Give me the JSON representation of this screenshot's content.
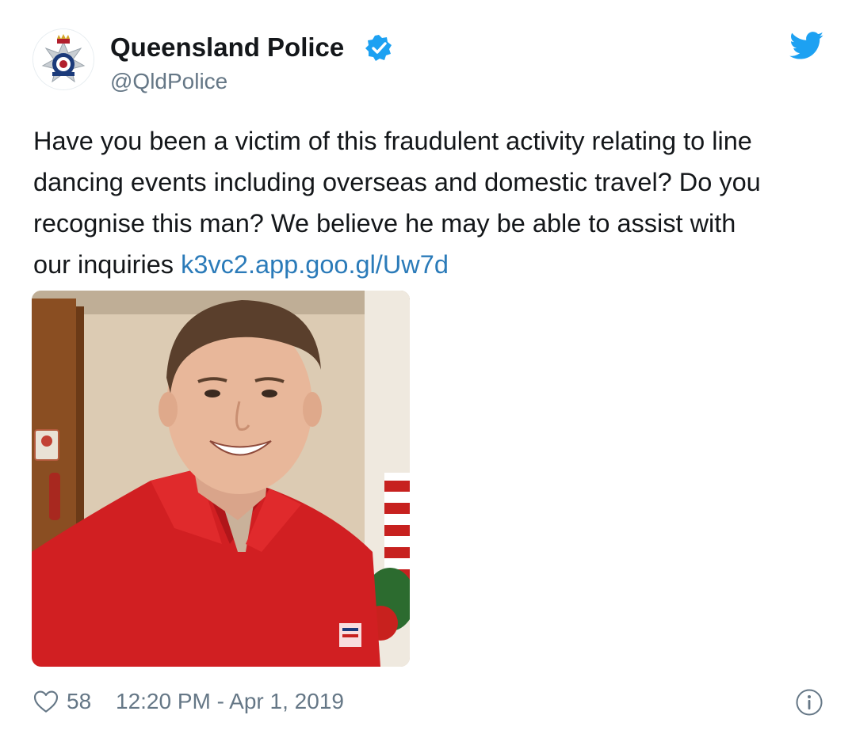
{
  "author": {
    "display_name": "Queensland Police",
    "handle": "@QldPolice",
    "verified": true,
    "avatar_icon": "police-badge-icon"
  },
  "tweet": {
    "text_lines": [
      "Have you been a victim of this fraudulent activity relating to line",
      "dancing events including overseas and domestic travel? Do you",
      "recognise this man? We believe he may be able to assist with",
      "our inquiries "
    ],
    "link_text": "k3vc2.app.goo.gl/Uw7d",
    "image_icon": "photo-of-man-in-red-shirt"
  },
  "footer": {
    "like_count": "58",
    "timestamp": "12:20 PM - Apr 1, 2019"
  },
  "icons": {
    "twitter": "twitter-bird-icon",
    "verified": "verified-badge-icon",
    "like": "heart-icon",
    "info": "info-icon"
  },
  "colors": {
    "link": "#2b7bb9",
    "twitter_blue": "#1da1f2",
    "secondary_text": "#657786",
    "primary_text": "#14171a"
  }
}
